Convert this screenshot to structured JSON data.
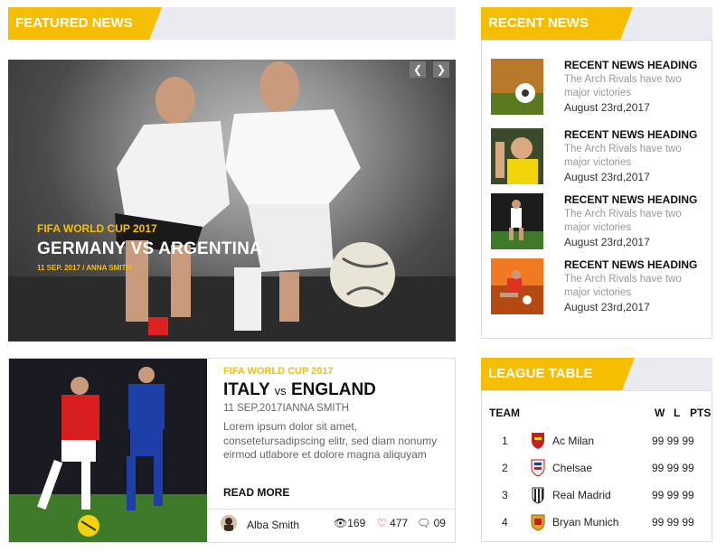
{
  "featured": {
    "header": "FEATURED NEWS",
    "category": "FIFA WORLD CUP 2017",
    "title": "GERMANY VS ARGENTINA",
    "meta": "11 SEP. 2017 / ANNA SMITH",
    "prev_icon": "chevron-left-icon",
    "next_icon": "chevron-right-icon"
  },
  "recent": {
    "header": "RECENT NEWS",
    "items": [
      {
        "heading": "RECENT NEWS HEADING",
        "text": "The Arch Rivals have two major victories",
        "date": "August 23rd,2017"
      },
      {
        "heading": "RECENT NEWS HEADING",
        "text": "The Arch Rivals have two major victories",
        "date": "August 23rd,2017"
      },
      {
        "heading": "RECENT NEWS HEADING",
        "text": "The Arch Rivals have two major victories",
        "date": "August 23rd,2017"
      },
      {
        "heading": "RECENT NEWS HEADING",
        "text": "The Arch Rivals have two major victories",
        "date": "August 23rd,2017"
      }
    ]
  },
  "article": {
    "category": "FIFA WORLD CUP 2017",
    "title_a": "ITALY",
    "title_vs": "vs",
    "title_b": "ENGLAND",
    "meta": "11 SEP,2017IANNA SMITH",
    "body": "Lorem ipsum dolor sit amet, consetetursadipscing elitr, sed diam nonumy eirmod utlabore et dolore magna aliquyam",
    "read_more": "READ MORE",
    "author": "Alba Smith",
    "views": "169",
    "likes": "477",
    "comments": "09"
  },
  "league": {
    "header": "LEAGUE TABLE",
    "col_team": "TEAM",
    "col_w": "W",
    "col_l": "L",
    "col_pts": "PTS",
    "rows": [
      {
        "rank": "1",
        "team": "Ac Milan",
        "stats": "99 99 99"
      },
      {
        "rank": "2",
        "team": "Chelsae",
        "stats": "99 99 99"
      },
      {
        "rank": "3",
        "team": "Real Madrid",
        "stats": "99 99 99"
      },
      {
        "rank": "4",
        "team": "Bryan Munich",
        "stats": "99 99 99"
      }
    ]
  },
  "colors": {
    "accent": "#f6be00",
    "header_bg": "#e9ebf1"
  }
}
